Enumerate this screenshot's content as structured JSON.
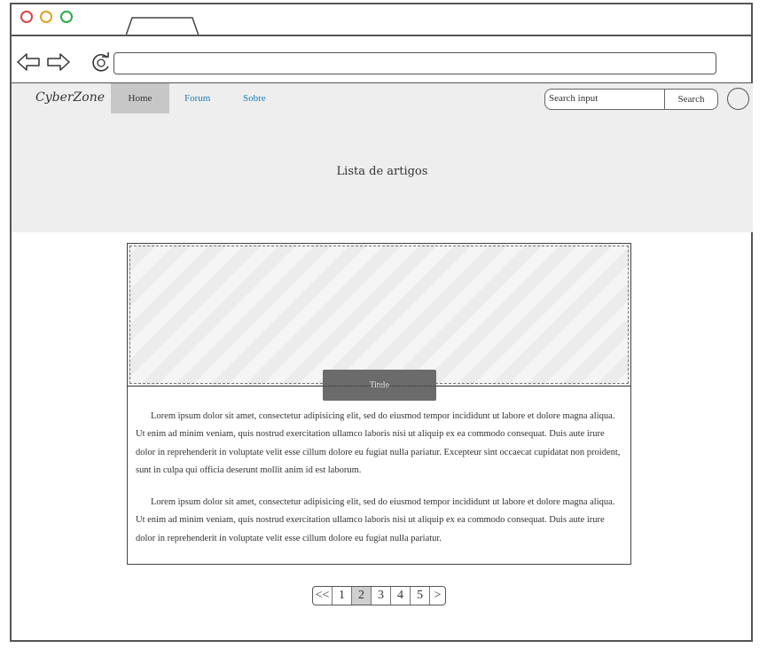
{
  "browser": {
    "window_controls": [
      "close-dot",
      "minimize-dot",
      "maximize-dot"
    ],
    "url": ""
  },
  "navbar": {
    "brand": "CyberZone",
    "items": [
      {
        "label": "Home",
        "active": true
      },
      {
        "label": "Forum",
        "active": false
      },
      {
        "label": "Sobre",
        "active": false
      }
    ],
    "search": {
      "placeholder": "Search input",
      "button_label": "Search"
    }
  },
  "hero": {
    "title": "Lista de artigos"
  },
  "article": {
    "title_tag": "Titulo",
    "paragraphs": [
      "Lorem ipsum dolor sit amet, consectetur adipisicing elit, sed do eiusmod tempor incididunt ut labore et dolore magna aliqua. Ut enim ad minim veniam, quis nostrud exercitation ullamco laboris nisi ut aliquip ex ea commodo consequat. Duis aute irure dolor in reprehenderit in voluptate velit esse cillum dolore eu fugiat nulla pariatur. Excepteur sint occaecat cupidatat non proident, sunt in culpa qui officia deserunt mollit anim id est laborum.",
      "Lorem ipsum dolor sit amet, consectetur adipisicing elit, sed do eiusmod tempor incididunt ut labore et dolore magna aliqua. Ut enim ad minim veniam, quis nostrud exercitation ullamco laboris nisi ut aliquip ex ea commodo consequat. Duis aute irure dolor in reprehenderit in voluptate velit esse cillum dolore eu fugiat nulla pariatur."
    ]
  },
  "pagination": {
    "first": "<<",
    "pages": [
      "1",
      "2",
      "3",
      "4",
      "5"
    ],
    "current": "2",
    "next": ">"
  },
  "colors": {
    "link": "#1a7fb8",
    "navbar_bg": "#eeeeee",
    "active_tab": "#c7c7c7",
    "title_tag": "#6b6b6b"
  }
}
